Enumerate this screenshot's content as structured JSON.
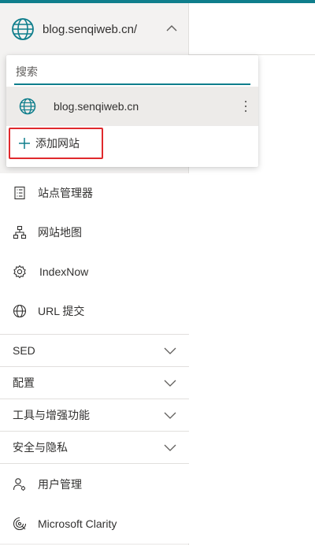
{
  "site_header": {
    "title": "blog.senqiweb.cn/",
    "globe_icon": "globe-icon",
    "chevron_icon": "chevron-up-icon"
  },
  "dropdown": {
    "search_placeholder": "搜索",
    "search_value": "",
    "site_option": {
      "label": "blog.senqiweb.cn",
      "icon": "globe-icon",
      "more_icon": "more-vertical-icon"
    },
    "add_site": {
      "label": "添加网站",
      "icon": "plus-icon"
    }
  },
  "nav": {
    "items": [
      {
        "label": "站点管理器",
        "icon": "list-icon"
      },
      {
        "label": "网站地图",
        "icon": "sitemap-icon"
      },
      {
        "label": "IndexNow",
        "icon": "gear-icon"
      },
      {
        "label": "URL 提交",
        "icon": "globe-icon"
      }
    ],
    "sections": [
      {
        "label": "SED"
      },
      {
        "label": "配置"
      },
      {
        "label": "工具与增强功能"
      },
      {
        "label": "安全与隐私"
      }
    ],
    "bottom_items": [
      {
        "label": "用户管理",
        "icon": "users-icon"
      },
      {
        "label": "Microsoft Clarity",
        "icon": "clarity-icon"
      }
    ]
  },
  "colors": {
    "accent": "#0f7e8c",
    "highlight_border": "#e0292d",
    "sidebar_bg": "#f3f2f1",
    "selected_bg": "#edebe9"
  }
}
